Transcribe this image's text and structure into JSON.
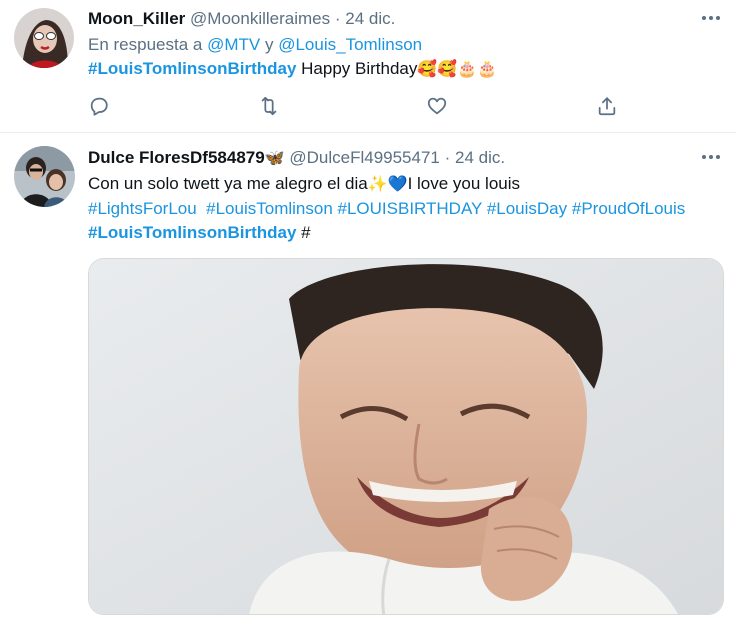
{
  "tweets": [
    {
      "name": "Moon_Killer",
      "handle": "@Moonkilleraimes",
      "dot": "·",
      "date": "24 dic.",
      "replying_prefix": "En respuesta a",
      "replying_to_1": "@MTV",
      "replying_and": "y",
      "replying_to_2": "@Louis_Tomlinson",
      "hashtag": "#LouisTomlinsonBirthday",
      "text": "Happy Birthday",
      "emojis": "🥰🥰🎂🎂",
      "more_icon": "more-horizontal-icon",
      "actions": {
        "reply_icon": "reply-icon",
        "retweet_icon": "retweet-icon",
        "like_icon": "like-icon",
        "share_icon": "share-icon"
      }
    },
    {
      "name": "Dulce FloresDf584879",
      "name_emoji": "🦋",
      "handle": "@DulceFl49955471",
      "dot": "·",
      "date": "24 dic.",
      "text_line1": "Con un solo twett ya me alegro el dia",
      "text_emojis": "✨💙",
      "text_line1_end": "I love you louis",
      "hashtags_line": [
        "#LightsForLou",
        "#LouisTomlinson",
        "#LOUISBIRTHDAY",
        "#LouisDay",
        "#ProudOfLouis"
      ],
      "hashtag_bold": "#LouisTomlinsonBirthday",
      "trailing": "#",
      "more_icon": "more-horizontal-icon",
      "media_alt": "photo of smiling man in white hoodie"
    }
  ],
  "colors": {
    "link": "#1b95e0",
    "secondary": "#5b7083",
    "divider": "#ebeef0"
  }
}
